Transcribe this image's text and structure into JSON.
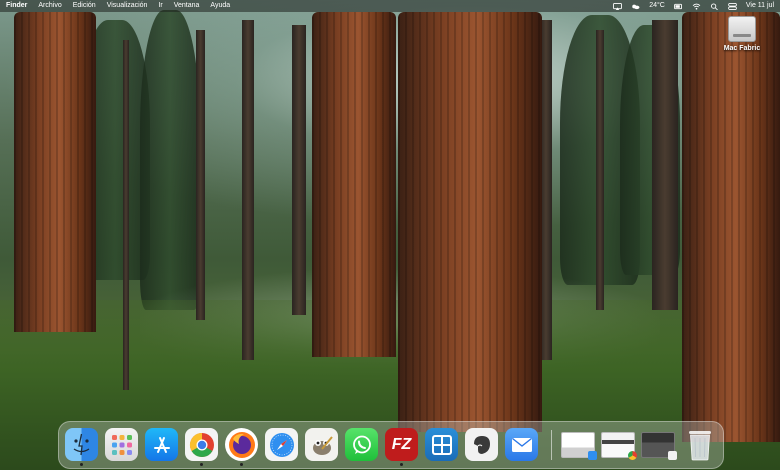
{
  "menubar": {
    "apple": "",
    "items": [
      {
        "label": "Finder"
      },
      {
        "label": "Archivo"
      },
      {
        "label": "Edición"
      },
      {
        "label": "Visualización"
      },
      {
        "label": "Ir"
      },
      {
        "label": "Ventana"
      },
      {
        "label": "Ayuda"
      }
    ],
    "status": {
      "weather": "24°C",
      "clock": "Vie 11 jul"
    }
  },
  "desktop": {
    "disk_label": "Mac Fabric"
  },
  "dock": {
    "apps": [
      {
        "name": "finder-icon"
      },
      {
        "name": "launchpad-icon"
      },
      {
        "name": "app-store-icon"
      },
      {
        "name": "chrome-icon"
      },
      {
        "name": "firefox-icon"
      },
      {
        "name": "safari-icon"
      },
      {
        "name": "gimp-icon"
      },
      {
        "name": "whatsapp-icon"
      },
      {
        "name": "filezilla-icon"
      },
      {
        "name": "remote-desktop-icon"
      },
      {
        "name": "evernote-icon"
      },
      {
        "name": "mail-icon"
      }
    ],
    "filezilla_label": "FZ",
    "trash": "trash-icon",
    "colors": {
      "finder": "#3a9cf0",
      "chrome_red": "#e2402f",
      "firefox": "#ff7a18",
      "whatsapp": "#27d045",
      "filezilla": "#bf1c1c",
      "mail": "#3d8cf3"
    }
  }
}
